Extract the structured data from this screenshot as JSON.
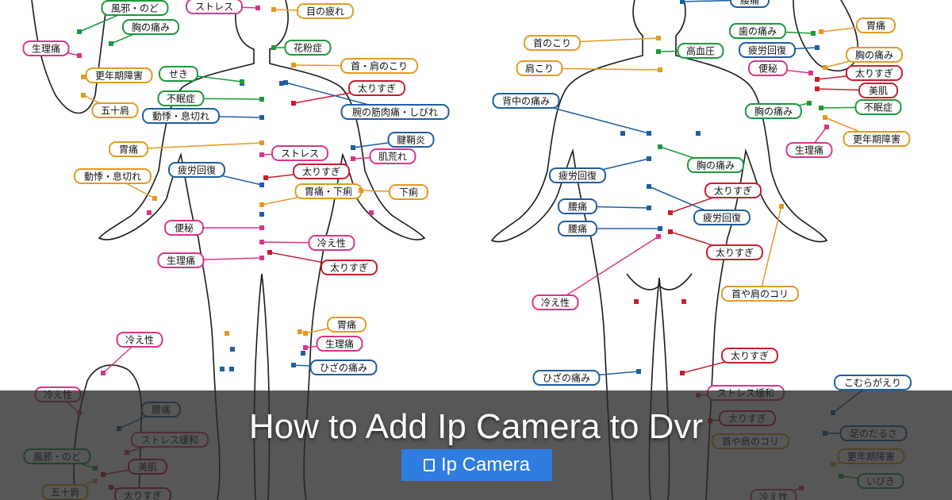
{
  "article": {
    "title": "How to Add Ip Camera to Dvr",
    "category": "Ip Camera",
    "category_icon": "category-icon"
  },
  "front_labels": [
    {
      "text": "風邪・のど",
      "color": "#1a9a3a"
    },
    {
      "text": "ストレス",
      "color": "#d8348a"
    },
    {
      "text": "目の疲れ",
      "color": "#e39a22"
    },
    {
      "text": "胸の痛み",
      "color": "#1a9a3a"
    },
    {
      "text": "生理痛",
      "color": "#d8348a"
    },
    {
      "text": "花粉症",
      "color": "#1a9a3a"
    },
    {
      "text": "首・肩のこり",
      "color": "#e39a22"
    },
    {
      "text": "更年期障害",
      "color": "#e39a22"
    },
    {
      "text": "せき",
      "color": "#1a9a3a"
    },
    {
      "text": "太りすぎ",
      "color": "#c81e2e"
    },
    {
      "text": "不眠症",
      "color": "#1a9a3a"
    },
    {
      "text": "五十肩",
      "color": "#e39a22"
    },
    {
      "text": "腕の筋肉痛・しびれ",
      "color": "#1e5fa0"
    },
    {
      "text": "動悸・息切れ",
      "color": "#1e5fa0"
    },
    {
      "text": "胃痛",
      "color": "#e39a22"
    },
    {
      "text": "ストレス",
      "color": "#d8348a"
    },
    {
      "text": "腱鞘炎",
      "color": "#1e5fa0"
    },
    {
      "text": "肌荒れ",
      "color": "#d8348a"
    },
    {
      "text": "動悸・息切れ",
      "color": "#e39a22"
    },
    {
      "text": "疲労回復",
      "color": "#1e5fa0"
    },
    {
      "text": "太りすぎ",
      "color": "#c81e2e"
    },
    {
      "text": "胃痛・下痢",
      "color": "#e39a22"
    },
    {
      "text": "下痢",
      "color": "#e39a22"
    },
    {
      "text": "便秘",
      "color": "#d8348a"
    },
    {
      "text": "冷え性",
      "color": "#d8348a"
    },
    {
      "text": "生理痛",
      "color": "#d8348a"
    },
    {
      "text": "太りすぎ",
      "color": "#c81e2e"
    },
    {
      "text": "冷え性",
      "color": "#d8348a"
    },
    {
      "text": "胃痛",
      "color": "#e39a22"
    },
    {
      "text": "生理痛",
      "color": "#d8348a"
    },
    {
      "text": "ひざの痛み",
      "color": "#1e5fa0"
    },
    {
      "text": "冷え性",
      "color": "#d8348a"
    },
    {
      "text": "腰痛",
      "color": "#1e5fa0"
    },
    {
      "text": "ストレス緩和",
      "color": "#d8348a"
    },
    {
      "text": "風邪・のど",
      "color": "#1a9a3a"
    },
    {
      "text": "美肌",
      "color": "#c81e2e"
    },
    {
      "text": "五十肩",
      "color": "#e39a22"
    },
    {
      "text": "太りすぎ",
      "color": "#c81e2e"
    }
  ],
  "back_labels": [
    {
      "text": "腰痛",
      "color": "#1e5fa0"
    },
    {
      "text": "胃痛",
      "color": "#e39a22"
    },
    {
      "text": "首のこり",
      "color": "#e39a22"
    },
    {
      "text": "歯の痛み",
      "color": "#1a9a3a"
    },
    {
      "text": "高血圧",
      "color": "#1a9a3a"
    },
    {
      "text": "肩こり",
      "color": "#e39a22"
    },
    {
      "text": "疲労回復",
      "color": "#1e5fa0"
    },
    {
      "text": "胸の痛み",
      "color": "#e39a22"
    },
    {
      "text": "便秘",
      "color": "#d8348a"
    },
    {
      "text": "太りすぎ",
      "color": "#c81e2e"
    },
    {
      "text": "背中の痛み",
      "color": "#1e5fa0"
    },
    {
      "text": "美肌",
      "color": "#c81e2e"
    },
    {
      "text": "不眠症",
      "color": "#1a9a3a"
    },
    {
      "text": "胸の痛み",
      "color": "#1a9a3a"
    },
    {
      "text": "更年期障害",
      "color": "#e39a22"
    },
    {
      "text": "生理痛",
      "color": "#d8348a"
    },
    {
      "text": "疲労回復",
      "color": "#1e5fa0"
    },
    {
      "text": "胸の痛み",
      "color": "#1a9a3a"
    },
    {
      "text": "太りすぎ",
      "color": "#c81e2e"
    },
    {
      "text": "腰痛",
      "color": "#1e5fa0"
    },
    {
      "text": "疲労回復",
      "color": "#1e5fa0"
    },
    {
      "text": "腰痛",
      "color": "#1e5fa0"
    },
    {
      "text": "太りすぎ",
      "color": "#c81e2e"
    },
    {
      "text": "冷え性",
      "color": "#d8348a"
    },
    {
      "text": "首や肩のコリ",
      "color": "#e39a22"
    },
    {
      "text": "太りすぎ",
      "color": "#c81e2e"
    },
    {
      "text": "ひざの痛み",
      "color": "#1e5fa0"
    },
    {
      "text": "こむらがえり",
      "color": "#1e5fa0"
    },
    {
      "text": "ストレス緩和",
      "color": "#d8348a"
    },
    {
      "text": "太りすぎ",
      "color": "#c81e2e"
    },
    {
      "text": "首や肩のコリ",
      "color": "#e39a22"
    },
    {
      "text": "足のだるさ",
      "color": "#1e5fa0"
    },
    {
      "text": "更年期障害",
      "color": "#e39a22"
    },
    {
      "text": "いびき",
      "color": "#1a9a3a"
    },
    {
      "text": "冷え性",
      "color": "#d8348a"
    }
  ]
}
